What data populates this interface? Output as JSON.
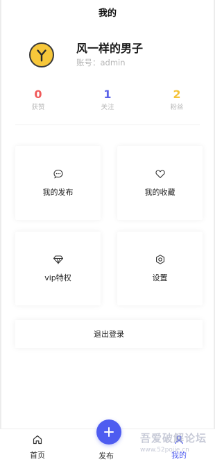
{
  "header": {
    "title": "我的"
  },
  "profile": {
    "name": "风一样的男子",
    "account": "账号：admin"
  },
  "stats": [
    {
      "value": "0",
      "label": "获赞",
      "color": "#f05a5a"
    },
    {
      "value": "1",
      "label": "关注",
      "color": "#5a62e8"
    },
    {
      "value": "2",
      "label": "粉丝",
      "color": "#f5c338"
    }
  ],
  "menu": {
    "my_posts": "我的发布",
    "my_favorites": "我的收藏",
    "vip": "vip特权",
    "settings": "设置"
  },
  "logout_label": "退出登录",
  "tabbar": {
    "home": "首页",
    "publish": "发布",
    "mine": "我的"
  },
  "watermark": {
    "main": "吾爱破解论坛",
    "sub": "www.52pojie.cn"
  },
  "colors": {
    "accent": "#4e5cf0",
    "avatar_bg": "#f7c73a"
  }
}
